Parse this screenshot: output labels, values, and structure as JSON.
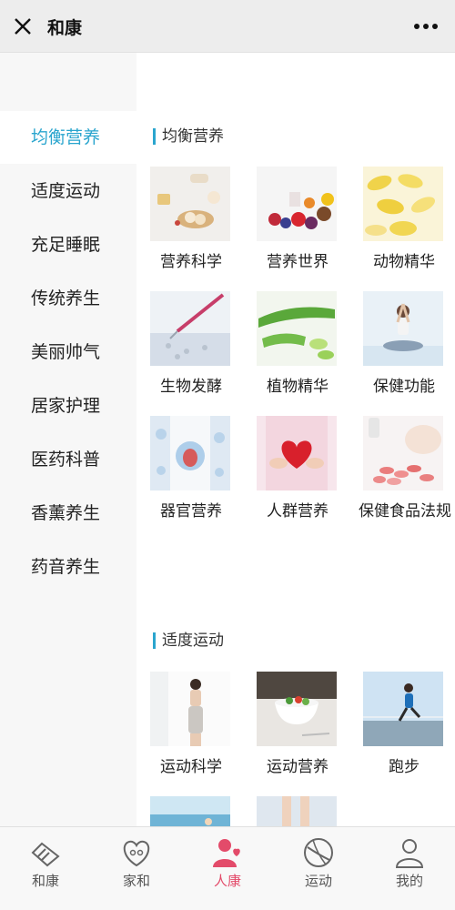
{
  "header": {
    "title": "和康",
    "close_icon": "close-icon",
    "more_icon": "more-dots-icon"
  },
  "colors": {
    "accent": "#2aa5ce",
    "active_nav": "#e34b6a",
    "sidebar_bg": "#f7f7f7"
  },
  "sidebar": {
    "items": [
      {
        "label": "均衡营养",
        "active": true
      },
      {
        "label": "适度运动"
      },
      {
        "label": "充足睡眠"
      },
      {
        "label": "传统养生"
      },
      {
        "label": "美丽帅气"
      },
      {
        "label": "居家护理"
      },
      {
        "label": "医药科普"
      },
      {
        "label": "香薰养生"
      },
      {
        "label": "药音养生"
      }
    ]
  },
  "main": {
    "sections": [
      {
        "title": "均衡营养",
        "tiles": [
          {
            "label": "营养科学",
            "icon": "food-platter-image"
          },
          {
            "label": "营养世界",
            "icon": "fruits-image"
          },
          {
            "label": "动物精华",
            "icon": "capsules-image"
          },
          {
            "label": "生物发酵",
            "icon": "pipette-lab-image"
          },
          {
            "label": "植物精华",
            "icon": "aloe-vera-image"
          },
          {
            "label": "保健功能",
            "icon": "yoga-image"
          },
          {
            "label": "器官营养",
            "icon": "doctor-organ-image"
          },
          {
            "label": "人群营养",
            "icon": "heart-hands-image"
          },
          {
            "label": "保健食品法规",
            "icon": "pills-bottle-image"
          }
        ]
      },
      {
        "title": "适度运动",
        "tiles": [
          {
            "label": "运动科学",
            "icon": "fitness-woman-image"
          },
          {
            "label": "运动营养",
            "icon": "salad-bowl-image"
          },
          {
            "label": "跑步",
            "icon": "runner-image"
          },
          {
            "label": "",
            "icon": "swimming-image"
          },
          {
            "label": "",
            "icon": "legs-image"
          }
        ]
      }
    ]
  },
  "bottom_nav": {
    "items": [
      {
        "label": "和康",
        "icon": "handshake-icon"
      },
      {
        "label": "家和",
        "icon": "heart-family-icon"
      },
      {
        "label": "人康",
        "icon": "person-heart-icon",
        "active": true
      },
      {
        "label": "运动",
        "icon": "ball-icon"
      },
      {
        "label": "我的",
        "icon": "user-icon"
      }
    ]
  }
}
